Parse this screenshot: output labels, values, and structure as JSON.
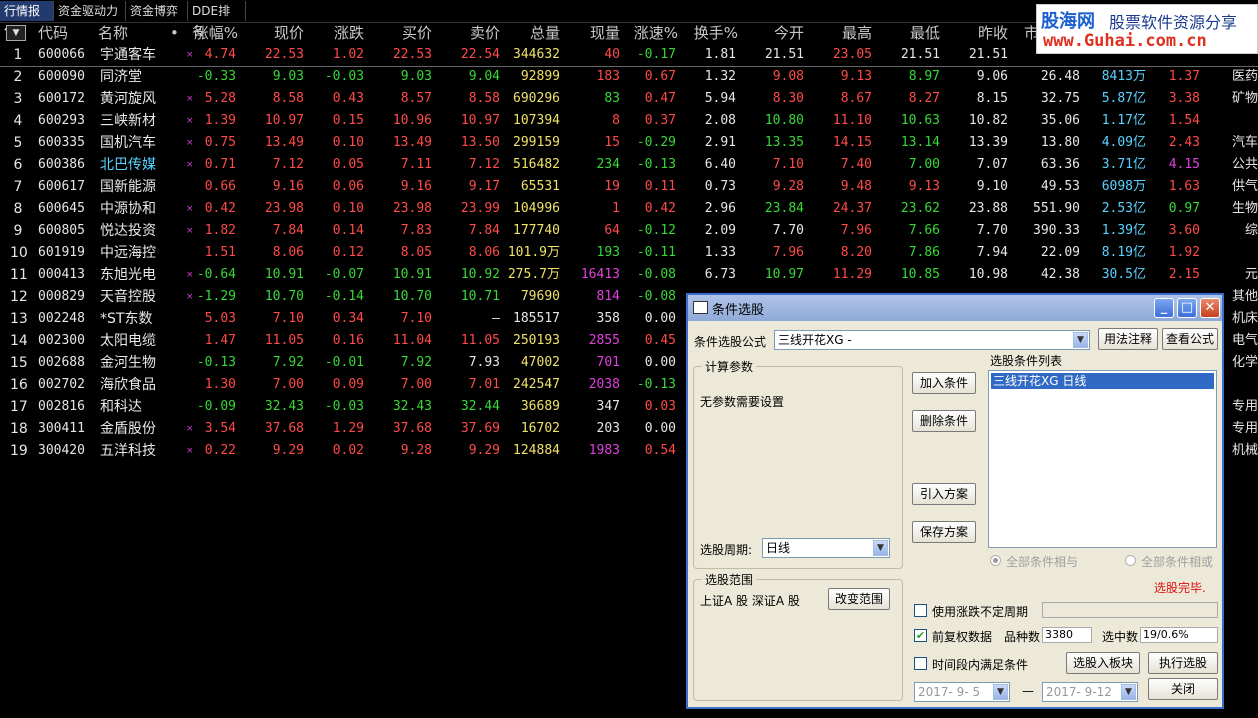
{
  "tabs": [
    "行情报价",
    "资金驱动力",
    "资金博弈",
    "DDE排名"
  ],
  "sort_icon": "triangle-down-icon",
  "columns": [
    "代码",
    "名称",
    "•",
    "涨幅%",
    "现价",
    "涨跌",
    "买价",
    "卖价",
    "总量",
    "现量",
    "涨速%",
    "换手%",
    "今开",
    "最高",
    "最低",
    "昨收",
    "市"
  ],
  "rows": [
    {
      "idx": "1",
      "code": "600066",
      "name": "宇通客车",
      "mark": "×",
      "chg_pct": "4.74",
      "price": "22.53",
      "chg": "1.02",
      "bid": "22.53",
      "ask": "22.54",
      "vol": "344632",
      "cur": "40",
      "speed": "-0.17",
      "turn": "1.81",
      "open": "21.51",
      "high": "23.05",
      "low": "21.51",
      "prev": "21.51",
      "pe": "",
      "cap": "",
      "e1": "",
      "ind": "",
      "ci": [
        "red",
        "red",
        "red",
        "red",
        "red",
        "yel",
        "red",
        "grn",
        "wht",
        "wht",
        "red",
        "wht",
        "wht"
      ]
    },
    {
      "idx": "2",
      "code": "600090",
      "name": "同济堂",
      "mark": "",
      "chg_pct": "-0.33",
      "price": "9.03",
      "chg": "-0.03",
      "bid": "9.03",
      "ask": "9.04",
      "vol": "92899",
      "cur": "183",
      "speed": "0.67",
      "turn": "1.32",
      "open": "9.08",
      "high": "9.13",
      "low": "8.97",
      "prev": "9.06",
      "pe": "26.48",
      "cap": "8413万",
      "e1": "1.37",
      "ind": "医药",
      "ci": [
        "grn",
        "grn",
        "grn",
        "grn",
        "grn",
        "yel",
        "red",
        "red",
        "wht",
        "red",
        "red",
        "grn",
        "wht"
      ]
    },
    {
      "idx": "3",
      "code": "600172",
      "name": "黄河旋风",
      "mark": "×",
      "chg_pct": "5.28",
      "price": "8.58",
      "chg": "0.43",
      "bid": "8.57",
      "ask": "8.58",
      "vol": "690296",
      "cur": "83",
      "speed": "0.47",
      "turn": "5.94",
      "open": "8.30",
      "high": "8.67",
      "low": "8.27",
      "prev": "8.15",
      "pe": "32.75",
      "cap": "5.87亿",
      "e1": "3.38",
      "ind": "矿物",
      "ci": [
        "red",
        "red",
        "red",
        "red",
        "red",
        "yel",
        "grn",
        "red",
        "wht",
        "red",
        "red",
        "red",
        "wht"
      ]
    },
    {
      "idx": "4",
      "code": "600293",
      "name": "三峡新材",
      "mark": "×",
      "chg_pct": "1.39",
      "price": "10.97",
      "chg": "0.15",
      "bid": "10.96",
      "ask": "10.97",
      "vol": "107394",
      "cur": "8",
      "speed": "0.37",
      "turn": "2.08",
      "open": "10.80",
      "high": "11.10",
      "low": "10.63",
      "prev": "10.82",
      "pe": "35.06",
      "cap": "1.17亿",
      "e1": "1.54",
      "ind": "",
      "ci": [
        "red",
        "red",
        "red",
        "red",
        "red",
        "yel",
        "red",
        "red",
        "wht",
        "grn",
        "red",
        "grn",
        "wht"
      ]
    },
    {
      "idx": "5",
      "code": "600335",
      "name": "国机汽车",
      "mark": "×",
      "chg_pct": "0.75",
      "price": "13.49",
      "chg": "0.10",
      "bid": "13.49",
      "ask": "13.50",
      "vol": "299159",
      "cur": "15",
      "speed": "-0.29",
      "turn": "2.91",
      "open": "13.35",
      "high": "14.15",
      "low": "13.14",
      "prev": "13.39",
      "pe": "13.80",
      "cap": "4.09亿",
      "e1": "2.43",
      "ind": "汽车",
      "ci": [
        "red",
        "red",
        "red",
        "red",
        "red",
        "yel",
        "red",
        "grn",
        "wht",
        "grn",
        "red",
        "grn",
        "wht"
      ]
    },
    {
      "idx": "6",
      "code": "600386",
      "name": "北巴传媒",
      "mark": "×",
      "chg_pct": "0.71",
      "price": "7.12",
      "chg": "0.05",
      "bid": "7.11",
      "ask": "7.12",
      "vol": "516482",
      "cur": "234",
      "speed": "-0.13",
      "turn": "6.40",
      "open": "7.10",
      "high": "7.40",
      "low": "7.00",
      "prev": "7.07",
      "pe": "63.36",
      "cap": "3.71亿",
      "e1": "4.15",
      "ind": "公共",
      "ci": [
        "red",
        "red",
        "red",
        "red",
        "red",
        "yel",
        "grn",
        "grn",
        "wht",
        "red",
        "red",
        "grn",
        "wht"
      ]
    },
    {
      "idx": "7",
      "code": "600617",
      "name": "国新能源",
      "mark": "",
      "chg_pct": "0.66",
      "price": "9.16",
      "chg": "0.06",
      "bid": "9.16",
      "ask": "9.17",
      "vol": "65531",
      "cur": "19",
      "speed": "0.11",
      "turn": "0.73",
      "open": "9.28",
      "high": "9.48",
      "low": "9.13",
      "prev": "9.10",
      "pe": "49.53",
      "cap": "6098万",
      "e1": "1.63",
      "ind": "供气",
      "ci": [
        "red",
        "red",
        "red",
        "red",
        "red",
        "yel",
        "red",
        "red",
        "wht",
        "red",
        "red",
        "red",
        "wht"
      ]
    },
    {
      "idx": "8",
      "code": "600645",
      "name": "中源协和",
      "mark": "×",
      "chg_pct": "0.42",
      "price": "23.98",
      "chg": "0.10",
      "bid": "23.98",
      "ask": "23.99",
      "vol": "104996",
      "cur": "1",
      "speed": "0.42",
      "turn": "2.96",
      "open": "23.84",
      "high": "24.37",
      "low": "23.62",
      "prev": "23.88",
      "pe": "551.90",
      "cap": "2.53亿",
      "e1": "0.97",
      "ind": "生物",
      "ci": [
        "red",
        "red",
        "red",
        "red",
        "red",
        "yel",
        "red",
        "red",
        "wht",
        "grn",
        "red",
        "grn",
        "wht"
      ]
    },
    {
      "idx": "9",
      "code": "600805",
      "name": "悦达投资",
      "mark": "×",
      "chg_pct": "1.82",
      "price": "7.84",
      "chg": "0.14",
      "bid": "7.83",
      "ask": "7.84",
      "vol": "177740",
      "cur": "64",
      "speed": "-0.12",
      "turn": "2.09",
      "open": "7.70",
      "high": "7.96",
      "low": "7.66",
      "prev": "7.70",
      "pe": "390.33",
      "cap": "1.39亿",
      "e1": "3.60",
      "ind": "综",
      "ci": [
        "red",
        "red",
        "red",
        "red",
        "red",
        "yel",
        "red",
        "grn",
        "wht",
        "wht",
        "red",
        "grn",
        "wht"
      ]
    },
    {
      "idx": "10",
      "code": "601919",
      "name": "中远海控",
      "mark": "",
      "chg_pct": "1.51",
      "price": "8.06",
      "chg": "0.12",
      "bid": "8.05",
      "ask": "8.06",
      "vol": "101.9万",
      "cur": "193",
      "speed": "-0.11",
      "turn": "1.33",
      "open": "7.96",
      "high": "8.20",
      "low": "7.86",
      "prev": "7.94",
      "pe": "22.09",
      "cap": "8.19亿",
      "e1": "1.92",
      "ind": "",
      "ci": [
        "red",
        "red",
        "red",
        "red",
        "red",
        "yel",
        "grn",
        "grn",
        "wht",
        "red",
        "red",
        "grn",
        "wht"
      ]
    },
    {
      "idx": "11",
      "code": "000413",
      "name": "东旭光电",
      "mark": "×",
      "chg_pct": "-0.64",
      "price": "10.91",
      "chg": "-0.07",
      "bid": "10.91",
      "ask": "10.92",
      "vol": "275.7万",
      "cur": "16413",
      "speed": "-0.08",
      "turn": "6.73",
      "open": "10.97",
      "high": "11.29",
      "low": "10.85",
      "prev": "10.98",
      "pe": "42.38",
      "cap": "30.5亿",
      "e1": "2.15",
      "ind": "元",
      "ci": [
        "grn",
        "grn",
        "grn",
        "grn",
        "grn",
        "yel",
        "mag",
        "grn",
        "wht",
        "grn",
        "red",
        "grn",
        "wht"
      ]
    },
    {
      "idx": "12",
      "code": "000829",
      "name": "天音控股",
      "mark": "×",
      "chg_pct": "-1.29",
      "price": "10.70",
      "chg": "-0.14",
      "bid": "10.70",
      "ask": "10.71",
      "vol": "79690",
      "cur": "814",
      "speed": "-0.08",
      "turn": "",
      "open": "",
      "high": "",
      "low": "",
      "prev": "",
      "pe": "",
      "cap": "",
      "e1": "",
      "ind": "其他",
      "ci": [
        "grn",
        "grn",
        "grn",
        "grn",
        "grn",
        "yel",
        "mag",
        "grn",
        "wht",
        "wht",
        "wht",
        "wht",
        "wht"
      ]
    },
    {
      "idx": "13",
      "code": "002248",
      "name": "*ST东数",
      "mark": "",
      "chg_pct": "5.03",
      "price": "7.10",
      "chg": "0.34",
      "bid": "7.10",
      "ask": "—",
      "vol": "185517",
      "cur": "358",
      "speed": "0.00",
      "turn": "",
      "open": "",
      "high": "",
      "low": "",
      "prev": "",
      "pe": "",
      "cap": "",
      "e1": "",
      "ind": "机床",
      "ci": [
        "red",
        "red",
        "red",
        "red",
        "wht",
        "wht",
        "wht",
        "wht",
        "wht",
        "wht",
        "wht",
        "wht",
        "wht"
      ]
    },
    {
      "idx": "14",
      "code": "002300",
      "name": "太阳电缆",
      "mark": "",
      "chg_pct": "1.47",
      "price": "11.05",
      "chg": "0.16",
      "bid": "11.04",
      "ask": "11.05",
      "vol": "250193",
      "cur": "2855",
      "speed": "0.45",
      "turn": "",
      "open": "",
      "high": "",
      "low": "",
      "prev": "",
      "pe": "",
      "cap": "",
      "e1": "",
      "ind": "电气",
      "ci": [
        "red",
        "red",
        "red",
        "red",
        "red",
        "yel",
        "mag",
        "red",
        "wht",
        "wht",
        "wht",
        "wht",
        "wht"
      ]
    },
    {
      "idx": "15",
      "code": "002688",
      "name": "金河生物",
      "mark": "",
      "chg_pct": "-0.13",
      "price": "7.92",
      "chg": "-0.01",
      "bid": "7.92",
      "ask": "7.93",
      "vol": "47002",
      "cur": "701",
      "speed": "0.00",
      "turn": "",
      "open": "",
      "high": "",
      "low": "",
      "prev": "",
      "pe": "",
      "cap": "",
      "e1": "",
      "ind": "化学",
      "ci": [
        "grn",
        "grn",
        "grn",
        "grn",
        "wht",
        "yel",
        "mag",
        "wht",
        "wht",
        "wht",
        "wht",
        "wht",
        "wht"
      ]
    },
    {
      "idx": "16",
      "code": "002702",
      "name": "海欣食品",
      "mark": "",
      "chg_pct": "1.30",
      "price": "7.00",
      "chg": "0.09",
      "bid": "7.00",
      "ask": "7.01",
      "vol": "242547",
      "cur": "2038",
      "speed": "-0.13",
      "turn": "",
      "open": "",
      "high": "",
      "low": "",
      "prev": "",
      "pe": "",
      "cap": "",
      "e1": "",
      "ind": "",
      "ci": [
        "red",
        "red",
        "red",
        "red",
        "red",
        "yel",
        "mag",
        "grn",
        "wht",
        "wht",
        "wht",
        "wht",
        "wht"
      ]
    },
    {
      "idx": "17",
      "code": "002816",
      "name": "和科达",
      "mark": "",
      "chg_pct": "-0.09",
      "price": "32.43",
      "chg": "-0.03",
      "bid": "32.43",
      "ask": "32.44",
      "vol": "36689",
      "cur": "347",
      "speed": "0.03",
      "turn": "",
      "open": "",
      "high": "",
      "low": "",
      "prev": "",
      "pe": "",
      "cap": "",
      "e1": "",
      "ind": "专用",
      "ci": [
        "grn",
        "grn",
        "grn",
        "grn",
        "grn",
        "yel",
        "wht",
        "red",
        "wht",
        "wht",
        "wht",
        "wht",
        "wht"
      ]
    },
    {
      "idx": "18",
      "code": "300411",
      "name": "金盾股份",
      "mark": "×",
      "chg_pct": "3.54",
      "price": "37.68",
      "chg": "1.29",
      "bid": "37.68",
      "ask": "37.69",
      "vol": "16702",
      "cur": "203",
      "speed": "0.00",
      "turn": "",
      "open": "",
      "high": "",
      "low": "",
      "prev": "",
      "pe": "",
      "cap": "",
      "e1": "",
      "ind": "专用",
      "ci": [
        "red",
        "red",
        "red",
        "red",
        "red",
        "yel",
        "wht",
        "wht",
        "wht",
        "wht",
        "wht",
        "wht",
        "wht"
      ]
    },
    {
      "idx": "19",
      "code": "300420",
      "name": "五洋科技",
      "mark": "×",
      "chg_pct": "0.22",
      "price": "9.29",
      "chg": "0.02",
      "bid": "9.28",
      "ask": "9.29",
      "vol": "124884",
      "cur": "1983",
      "speed": "0.54",
      "turn": "",
      "open": "",
      "high": "",
      "low": "",
      "prev": "",
      "pe": "",
      "cap": "",
      "e1": "",
      "ind": "机械",
      "ci": [
        "red",
        "red",
        "red",
        "red",
        "red",
        "yel",
        "mag",
        "red",
        "wht",
        "wht",
        "wht",
        "wht",
        "wht"
      ]
    }
  ],
  "watermark": {
    "brand": "股海网",
    "slogan": "股票软件资源分享",
    "url": "www.Guhai.com.cn"
  },
  "dialog": {
    "title": "条件选股",
    "title_icon": "window-icon",
    "formula_label": "条件选股公式",
    "formula_value": "三线开花XG   -",
    "help_btn": "用法注释",
    "view_btn": "查看公式",
    "params_group": "计算参数",
    "params_text": "无参数需要设置",
    "period_label": "选股周期:",
    "period_value": "日线",
    "add_btn": "加入条件",
    "del_btn": "删除条件",
    "import_btn": "引入方案",
    "save_btn": "保存方案",
    "cond_list_label": "选股条件列表",
    "cond_item": "三线开花XG   日线",
    "radio_and": "全部条件相与",
    "radio_or": "全部条件相或",
    "status": "选股完毕.",
    "range_group": "选股范围",
    "range_text": "上证A 股  深证A 股",
    "change_range_btn": "改变范围",
    "uncertain_period": "使用涨跌不定周期",
    "fq_label": "前复权数据",
    "count_label": "品种数",
    "count_value": "3380",
    "selected_label": "选中数",
    "selected_value": "19/0.6%",
    "time_cond": "时间段内满足条件",
    "to_block_btn": "选股入板块",
    "run_btn": "执行选股",
    "date_from": "2017- 9- 5",
    "date_sep": "—",
    "date_to": "2017- 9-12",
    "close_btn": "关闭"
  },
  "colors": {
    "up": "#ff4a4a",
    "down": "#38d838",
    "volume": "#f0e268",
    "bigvol": "#e040e0",
    "name_hl": "#5ad2ff"
  }
}
